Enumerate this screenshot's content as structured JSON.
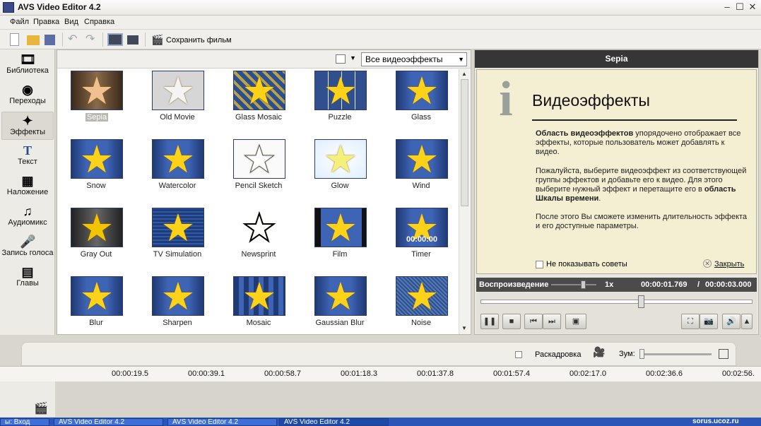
{
  "window": {
    "title": "AVS Video Editor 4.2"
  },
  "menu": [
    "Файл",
    "Правка",
    "Вид",
    "Справка"
  ],
  "toolbar": {
    "save_film": "Сохранить фильм"
  },
  "sidebar": [
    {
      "label": "Библиотека",
      "icon": "library-icon"
    },
    {
      "label": "Переходы",
      "icon": "transitions-icon"
    },
    {
      "label": "Эффекты",
      "icon": "effects-icon",
      "active": true
    },
    {
      "label": "Текст",
      "icon": "text-icon"
    },
    {
      "label": "Наложение",
      "icon": "overlay-icon"
    },
    {
      "label": "Аудиомикс",
      "icon": "audiomix-icon"
    },
    {
      "label": "Запись голоса",
      "icon": "microphone-icon"
    },
    {
      "label": "Главы",
      "icon": "chapters-icon"
    }
  ],
  "effects": {
    "filter_value": "Все видеоэффекты",
    "items": [
      "Sepia",
      "Old Movie",
      "Glass Mosaic",
      "Puzzle",
      "Glass",
      "Snow",
      "Watercolor",
      "Pencil Sketch",
      "Glow",
      "Wind",
      "Gray Out",
      "TV Simulation",
      "Newsprint",
      "Film",
      "Timer",
      "Blur",
      "Sharpen",
      "Mosaic",
      "Gaussian Blur",
      "Noise"
    ],
    "selected": "Sepia",
    "timer_overlay": "00:00:00"
  },
  "preview": {
    "title": "Sepia",
    "tip_heading": "Видеоэффекты",
    "tip_p1_bold": "Область видеоэффектов",
    "tip_p1": " упорядочено отображает все эффекты, которые пользователь может добавлять к видео.",
    "tip_p2": "Пожалуйста, выберите видеоэффект из соответствующей группы эффектов и добавьте его к видео. Для этого выберите нужный эффект и перетащите его в ",
    "tip_p2_bold": "область Шкалы времени",
    "tip_p2_end": ".",
    "tip_p3": "После этого Вы сможете изменить длительность эффекта и его доступные параметры.",
    "dont_show": "Не показывать советы",
    "close": "Закрыть",
    "playback_label": "Воспроизведение",
    "speed": "1x",
    "time_current": "00:00:01.769",
    "time_sep": "/",
    "time_total": "00:00:03.000",
    "position": 0.59
  },
  "timeline": {
    "storyboard": "Раскадровка",
    "zoom": "Зум:",
    "ticks": [
      "00:00:19.5",
      "00:00:39.1",
      "00:00:58.7",
      "00:01:18.3",
      "00:01:37.8",
      "00:01:57.4",
      "00:02:17.0",
      "00:02:36.6",
      "00:02:56."
    ]
  },
  "taskbar": {
    "items": [
      "ы: Вход",
      "AVS Video Editor 4.2",
      "AVS Video Editor 4.2",
      "AVS Video Editor 4.2"
    ],
    "tray_text": "sorus.ucoz.ru"
  }
}
